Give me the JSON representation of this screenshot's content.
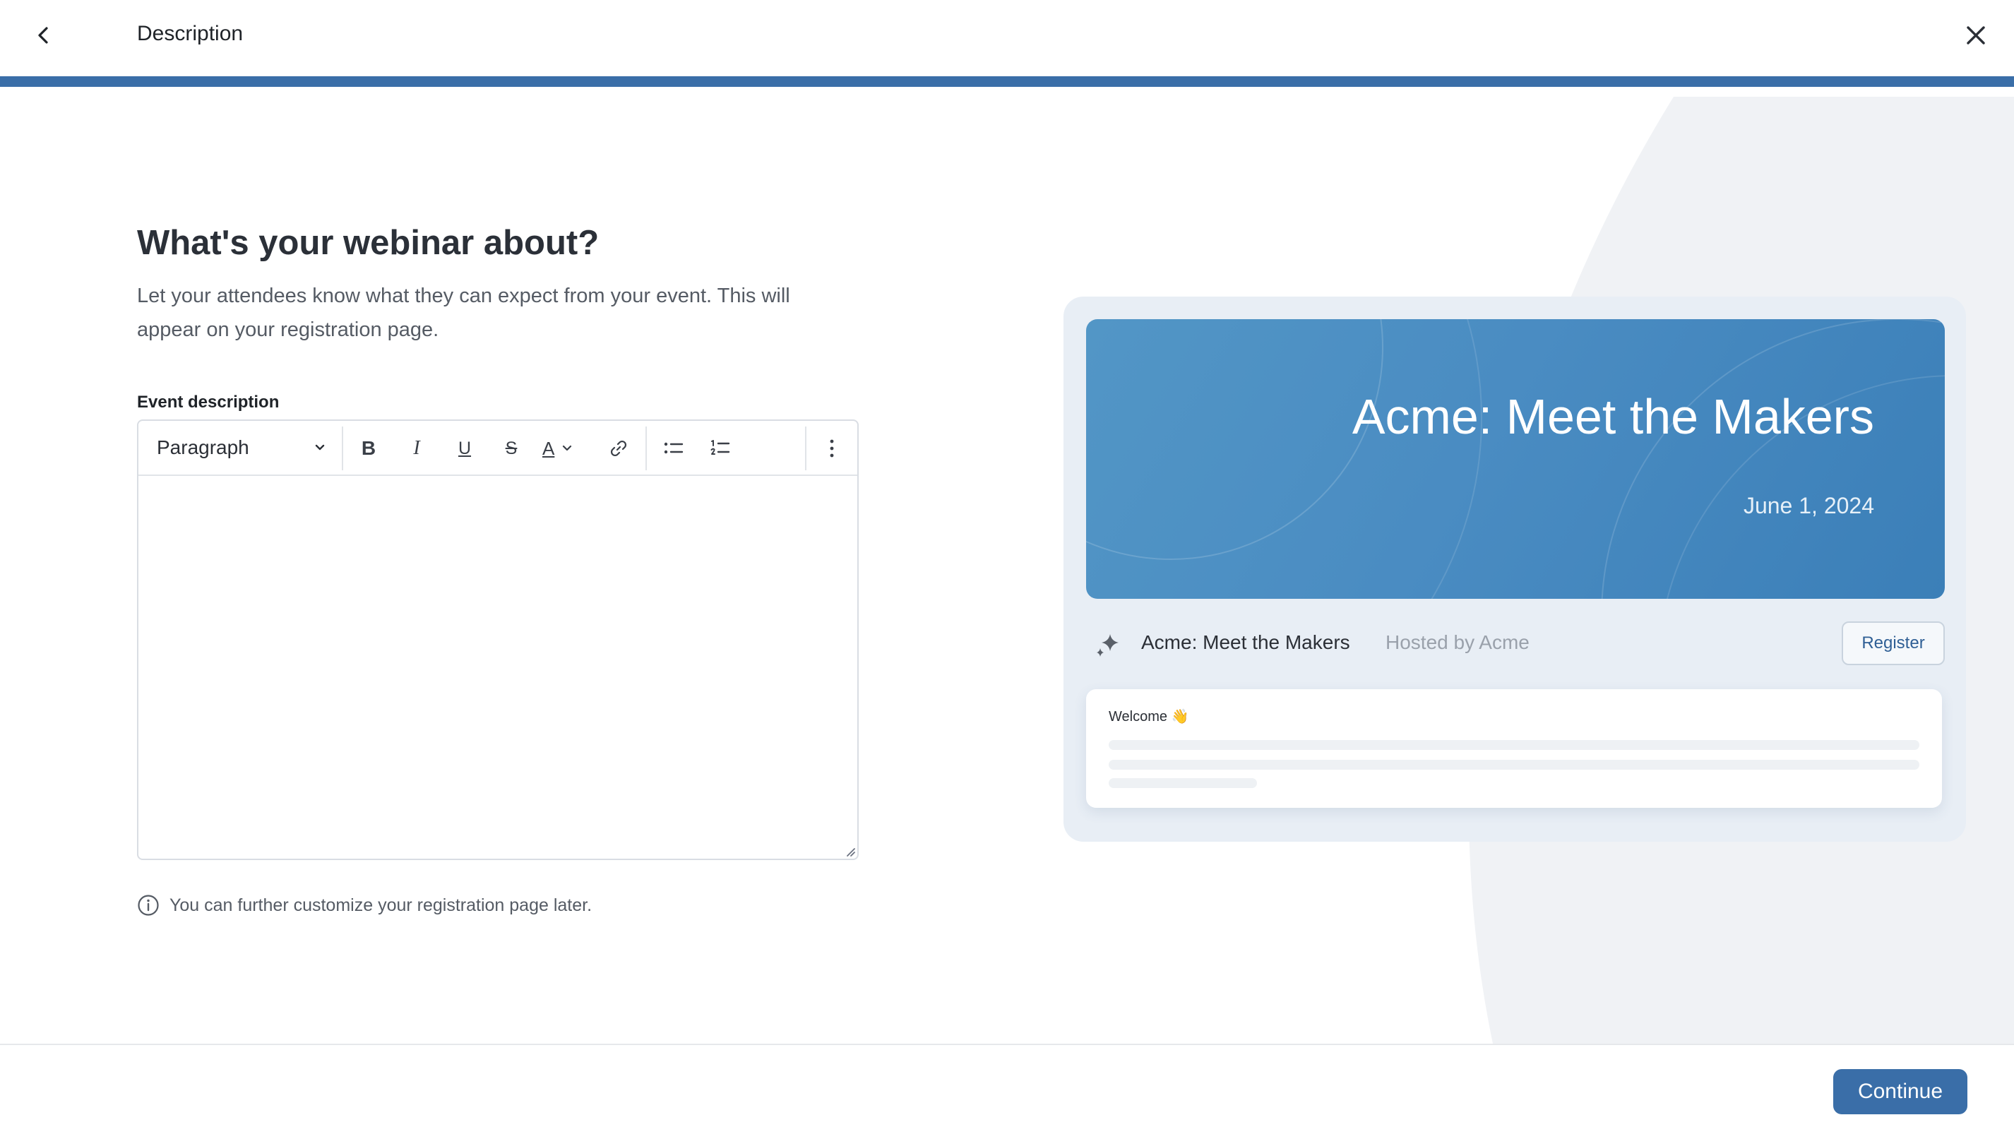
{
  "header": {
    "title": "Description",
    "back_icon": "chevron-left-icon",
    "close_icon": "close-icon"
  },
  "progress": {
    "fraction": 1.0,
    "color": "#3a6ea8"
  },
  "form": {
    "heading": "What's your webinar about?",
    "subtitle": "Let your attendees know what they can expect from your event. This will appear on your registration page.",
    "field_label": "Event description",
    "editor": {
      "block_format": "Paragraph",
      "value": "",
      "tools": [
        "bold-icon",
        "italic-icon",
        "underline-icon",
        "strikethrough-icon",
        "text-color-icon",
        "link-icon",
        "bulleted-list-icon",
        "numbered-list-icon",
        "more-icon"
      ]
    },
    "hint": "You can further customize your registration page later."
  },
  "preview": {
    "banner_title": "Acme: Meet the Makers",
    "banner_date": "June 1, 2024",
    "event_name": "Acme: Meet the Makers",
    "hosted_by": "Hosted by Acme",
    "register_label": "Register",
    "welcome": "Welcome 👋"
  },
  "footer": {
    "continue_label": "Continue"
  },
  "colors": {
    "accent": "#3a6ea8",
    "banner": "#4a8cc2",
    "preview_bg": "#e8eef5"
  }
}
